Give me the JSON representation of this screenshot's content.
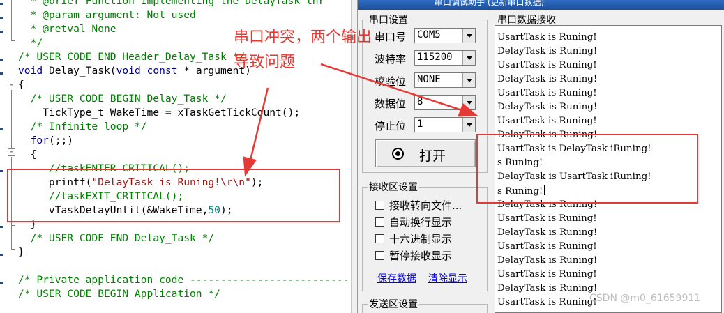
{
  "editor": {
    "lines": [
      {
        "parts": [
          {
            "c": "cm",
            "t": "  * @brief Function implementing the DelayTask thr"
          }
        ]
      },
      {
        "parts": [
          {
            "c": "cm",
            "t": "  * @param argument: Not used"
          }
        ]
      },
      {
        "parts": [
          {
            "c": "cm",
            "t": "  * @retval None"
          }
        ]
      },
      {
        "parts": [
          {
            "c": "cm",
            "t": "  */"
          }
        ]
      },
      {
        "parts": [
          {
            "c": "cm",
            "t": "/* USER CODE END Header_Delay_Task */"
          }
        ]
      },
      {
        "parts": [
          {
            "c": "kw",
            "t": "void"
          },
          {
            "c": "",
            "t": " Delay_Task("
          },
          {
            "c": "kw",
            "t": "void"
          },
          {
            "c": "",
            "t": " "
          },
          {
            "c": "kw",
            "t": "const"
          },
          {
            "c": "",
            "t": " * argument)"
          }
        ]
      },
      {
        "parts": [
          {
            "c": "",
            "t": "{"
          }
        ]
      },
      {
        "parts": [
          {
            "c": "cm",
            "t": "  /* USER CODE BEGIN Delay_Task */"
          }
        ]
      },
      {
        "parts": [
          {
            "c": "",
            "t": "    TickType_t WakeTime = xTaskGetTickCount();"
          }
        ]
      },
      {
        "parts": [
          {
            "c": "cm",
            "t": "  /* Infinite loop */"
          }
        ]
      },
      {
        "parts": [
          {
            "c": "kw",
            "t": "  for"
          },
          {
            "c": "",
            "t": "(;;)"
          }
        ]
      },
      {
        "parts": [
          {
            "c": "",
            "t": "  {"
          }
        ]
      },
      {
        "parts": [
          {
            "c": "cm",
            "t": "     //taskENTER_CRITICAL();"
          }
        ]
      },
      {
        "parts": [
          {
            "c": "",
            "t": "     printf("
          },
          {
            "c": "st",
            "t": "\"DelayTask is Runing!\\r\\n\""
          },
          {
            "c": "",
            "t": ");"
          }
        ]
      },
      {
        "parts": [
          {
            "c": "cm",
            "t": "     //taskEXIT_CRITICAL();"
          }
        ]
      },
      {
        "parts": [
          {
            "c": "",
            "t": "     vTaskDelayUntil(&WakeTime,"
          },
          {
            "c": "nu",
            "t": "50"
          },
          {
            "c": "",
            "t": ");"
          }
        ]
      },
      {
        "parts": [
          {
            "c": "",
            "t": "  }"
          }
        ]
      },
      {
        "parts": [
          {
            "c": "cm",
            "t": "  /* USER CODE END Delay_Task */"
          }
        ]
      },
      {
        "parts": [
          {
            "c": "",
            "t": "}"
          }
        ]
      },
      {
        "parts": [
          {
            "c": "",
            "t": ""
          }
        ]
      },
      {
        "parts": [
          {
            "c": "cm",
            "t": "/* Private application code --------------------------"
          }
        ]
      },
      {
        "parts": [
          {
            "c": "cm",
            "t": "/* USER CODE BEGIN Application */"
          }
        ]
      }
    ]
  },
  "app": {
    "title": "串口调试助手 (更新串口数据)",
    "serial_settings": {
      "group_title": "串口设置",
      "fields": [
        {
          "label": "串口号",
          "value": "COM5"
        },
        {
          "label": "波特率",
          "value": "115200"
        },
        {
          "label": "校验位",
          "value": "NONE"
        },
        {
          "label": "数据位",
          "value": "8"
        },
        {
          "label": "停止位",
          "value": "1"
        }
      ],
      "open_button": "打开"
    },
    "rx_settings": {
      "group_title": "接收区设置",
      "options": [
        {
          "label": "接收转向文件...",
          "checked": false
        },
        {
          "label": "自动换行显示",
          "checked": false
        },
        {
          "label": "十六进制显示",
          "checked": false
        },
        {
          "label": "暂停接收显示",
          "checked": false
        }
      ],
      "save_link": "保存数据",
      "clear_link": "清除显示"
    },
    "tx_settings": {
      "group_title": "发送区设置"
    },
    "rx_area": {
      "group_title": "串口数据接收",
      "lines": [
        "UsartTask is Runing!",
        "DelayTask is Runing!",
        "UsartTask is Runing!",
        "DelayTask is Runing!",
        "UsartTask is Runing!",
        "DelayTask is Runing!",
        "UsartTask is Runing!",
        "DelayTask is Runing!",
        "UsartTask is DelayTask iRuning!",
        "s Runing!",
        "DelayTask is UsartTask iRuning!",
        "s Runing!",
        "DelayTask is Runing!",
        "UsartTask is Runing!",
        "DelayTask is Runing!",
        "UsartTask is Runing!",
        "DelayTask is Runing!",
        "UsartTask is Runing!",
        "DelayTask is Runing!",
        "UsartTask is Runing!"
      ]
    }
  },
  "annotation": {
    "line1": "串口冲突，两个输出",
    "line2": "导致问题",
    "color": "#e53935"
  },
  "watermark": "CSDN @m0_61659911"
}
